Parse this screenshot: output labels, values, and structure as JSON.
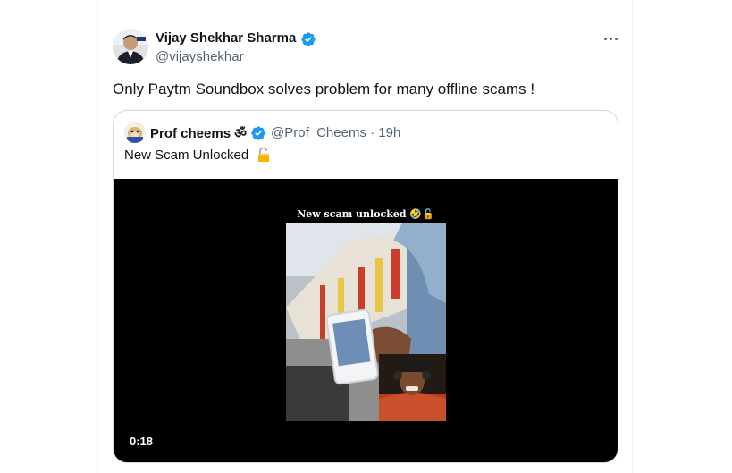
{
  "tweet": {
    "author_name": "Vijay Shekhar Sharma",
    "author_handle": "@vijayshekhar",
    "text": "Only Paytm Soundbox solves problem for many offline scams !",
    "verified": true,
    "more_icon": "more-horizontal-icon"
  },
  "quote": {
    "author_name": "Prof cheems ॐ",
    "author_handle": "@Prof_Cheems",
    "separator": "·",
    "time": "19h",
    "text": "New Scam Unlocked",
    "emoji_icon": "unlocked-padlock-icon",
    "video": {
      "caption": "New scam unlocked 🤣🔓",
      "duration": "0:18"
    }
  },
  "colors": {
    "verified_blue": "#1d9bf0",
    "secondary_text": "#536471",
    "border": "#cfd9de"
  }
}
